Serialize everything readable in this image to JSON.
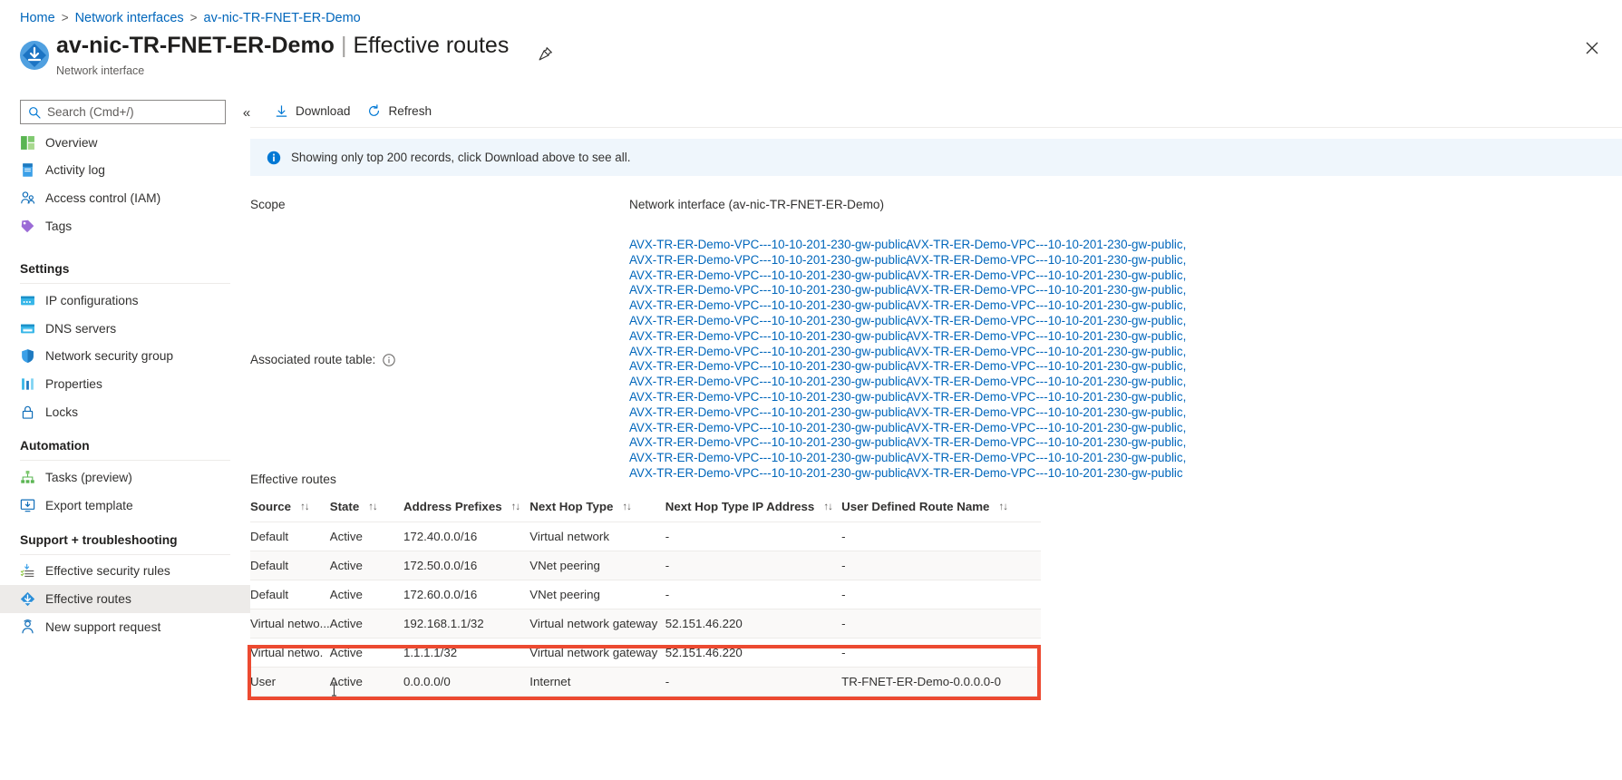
{
  "breadcrumb": {
    "items": [
      {
        "label": "Home"
      },
      {
        "label": "Network interfaces"
      },
      {
        "label": "av-nic-TR-FNET-ER-Demo"
      }
    ],
    "separator": ">"
  },
  "header": {
    "resource_name": "av-nic-TR-FNET-ER-Demo",
    "divider": "|",
    "blade_name": "Effective routes",
    "resource_type": "Network interface",
    "pin_tooltip": "Pin to dashboard",
    "close_tooltip": "Close"
  },
  "sidebar": {
    "search": {
      "placeholder": "Search (Cmd+/)",
      "value": ""
    },
    "collapse_label": "«",
    "items": [
      {
        "label": "Overview",
        "icon": "overview-icon",
        "type": "item",
        "selected": false
      },
      {
        "label": "Activity log",
        "icon": "activity-log-icon",
        "type": "item",
        "selected": false
      },
      {
        "label": "Access control (IAM)",
        "icon": "access-control-icon",
        "type": "item",
        "selected": false
      },
      {
        "label": "Tags",
        "icon": "tags-icon",
        "type": "item",
        "selected": false
      },
      {
        "label": "Settings",
        "type": "group"
      },
      {
        "label": "IP configurations",
        "icon": "ip-configurations-icon",
        "type": "item",
        "selected": false
      },
      {
        "label": "DNS servers",
        "icon": "dns-servers-icon",
        "type": "item",
        "selected": false
      },
      {
        "label": "Network security group",
        "icon": "shield-icon",
        "type": "item",
        "selected": false
      },
      {
        "label": "Properties",
        "icon": "properties-icon",
        "type": "item",
        "selected": false
      },
      {
        "label": "Locks",
        "icon": "lock-icon",
        "type": "item",
        "selected": false
      },
      {
        "label": "Automation",
        "type": "group"
      },
      {
        "label": "Tasks (preview)",
        "icon": "tasks-icon",
        "type": "item",
        "selected": false
      },
      {
        "label": "Export template",
        "icon": "export-template-icon",
        "type": "item",
        "selected": false
      },
      {
        "label": "Support + troubleshooting",
        "type": "group"
      },
      {
        "label": "Effective security rules",
        "icon": "effective-security-rules-icon",
        "type": "item",
        "selected": false
      },
      {
        "label": "Effective routes",
        "icon": "effective-routes-icon",
        "type": "item",
        "selected": true
      },
      {
        "label": "New support request",
        "icon": "support-request-icon",
        "type": "item",
        "selected": false
      }
    ]
  },
  "toolbar": {
    "download_label": "Download",
    "refresh_label": "Refresh"
  },
  "banner": {
    "text": "Showing only top 200 records, click Download above to see all.",
    "icon": "info-icon",
    "background": "#eff6fc",
    "icon_color": "#0078d4"
  },
  "scope": {
    "label": "Scope",
    "value": "Network interface (av-nic-TR-FNET-ER-Demo)"
  },
  "associated_route_table": {
    "label": "Associated route table:",
    "info_icon": "info-circle-icon",
    "link_color": "#0066bb",
    "columns": [
      [
        "AVX-TR-ER-Demo-VPC---10-10-201-230-gw-public,",
        "AVX-TR-ER-Demo-VPC---10-10-201-230-gw-public,",
        "AVX-TR-ER-Demo-VPC---10-10-201-230-gw-public,",
        "AVX-TR-ER-Demo-VPC---10-10-201-230-gw-public,",
        "AVX-TR-ER-Demo-VPC---10-10-201-230-gw-public,",
        "AVX-TR-ER-Demo-VPC---10-10-201-230-gw-public,",
        "AVX-TR-ER-Demo-VPC---10-10-201-230-gw-public,",
        "AVX-TR-ER-Demo-VPC---10-10-201-230-gw-public,",
        "AVX-TR-ER-Demo-VPC---10-10-201-230-gw-public,",
        "AVX-TR-ER-Demo-VPC---10-10-201-230-gw-public,",
        "AVX-TR-ER-Demo-VPC---10-10-201-230-gw-public,",
        "AVX-TR-ER-Demo-VPC---10-10-201-230-gw-public,",
        "AVX-TR-ER-Demo-VPC---10-10-201-230-gw-public,",
        "AVX-TR-ER-Demo-VPC---10-10-201-230-gw-public,",
        "AVX-TR-ER-Demo-VPC---10-10-201-230-gw-public,",
        "AVX-TR-ER-Demo-VPC---10-10-201-230-gw-public,"
      ],
      [
        "AVX-TR-ER-Demo-VPC---10-10-201-230-gw-public,",
        "AVX-TR-ER-Demo-VPC---10-10-201-230-gw-public,",
        "AVX-TR-ER-Demo-VPC---10-10-201-230-gw-public,",
        "AVX-TR-ER-Demo-VPC---10-10-201-230-gw-public,",
        "AVX-TR-ER-Demo-VPC---10-10-201-230-gw-public,",
        "AVX-TR-ER-Demo-VPC---10-10-201-230-gw-public,",
        "AVX-TR-ER-Demo-VPC---10-10-201-230-gw-public,",
        "AVX-TR-ER-Demo-VPC---10-10-201-230-gw-public,",
        "AVX-TR-ER-Demo-VPC---10-10-201-230-gw-public,",
        "AVX-TR-ER-Demo-VPC---10-10-201-230-gw-public,",
        "AVX-TR-ER-Demo-VPC---10-10-201-230-gw-public,",
        "AVX-TR-ER-Demo-VPC---10-10-201-230-gw-public,",
        "AVX-TR-ER-Demo-VPC---10-10-201-230-gw-public,",
        "AVX-TR-ER-Demo-VPC---10-10-201-230-gw-public,",
        "AVX-TR-ER-Demo-VPC---10-10-201-230-gw-public,",
        "AVX-TR-ER-Demo-VPC---10-10-201-230-gw-public"
      ]
    ]
  },
  "effective_routes": {
    "title": "Effective routes",
    "sort_glyph": "↑↓",
    "columns": [
      "Source",
      "State",
      "Address Prefixes",
      "Next Hop Type",
      "Next Hop Type IP Address",
      "User Defined Route Name"
    ],
    "rows": [
      {
        "source": "Default",
        "state": "Active",
        "address_prefixes": "172.40.0.0/16",
        "next_hop_type": "Virtual network",
        "next_hop_ip": "-",
        "udr_name": "-",
        "highlighted": false
      },
      {
        "source": "Default",
        "state": "Active",
        "address_prefixes": "172.50.0.0/16",
        "next_hop_type": "VNet peering",
        "next_hop_ip": "-",
        "udr_name": "-",
        "highlighted": false
      },
      {
        "source": "Default",
        "state": "Active",
        "address_prefixes": "172.60.0.0/16",
        "next_hop_type": "VNet peering",
        "next_hop_ip": "-",
        "udr_name": "-",
        "highlighted": false
      },
      {
        "source": "Virtual netwo...",
        "state": "Active",
        "address_prefixes": "192.168.1.1/32",
        "next_hop_type": "Virtual network gateway",
        "next_hop_ip": "52.151.46.220",
        "udr_name": "-",
        "highlighted": true
      },
      {
        "source": "Virtual netwo.",
        "state": "Active",
        "address_prefixes": "1.1.1.1/32",
        "next_hop_type": "Virtual network gateway",
        "next_hop_ip": "52.151.46.220",
        "udr_name": "-",
        "highlighted": true
      },
      {
        "source": "User",
        "state": "Active",
        "address_prefixes": "0.0.0.0/0",
        "next_hop_type": "Internet",
        "next_hop_ip": "-",
        "udr_name": "TR-FNET-ER-Demo-0.0.0.0-0",
        "highlighted": false
      }
    ],
    "highlight_color": "#ec4a31"
  }
}
